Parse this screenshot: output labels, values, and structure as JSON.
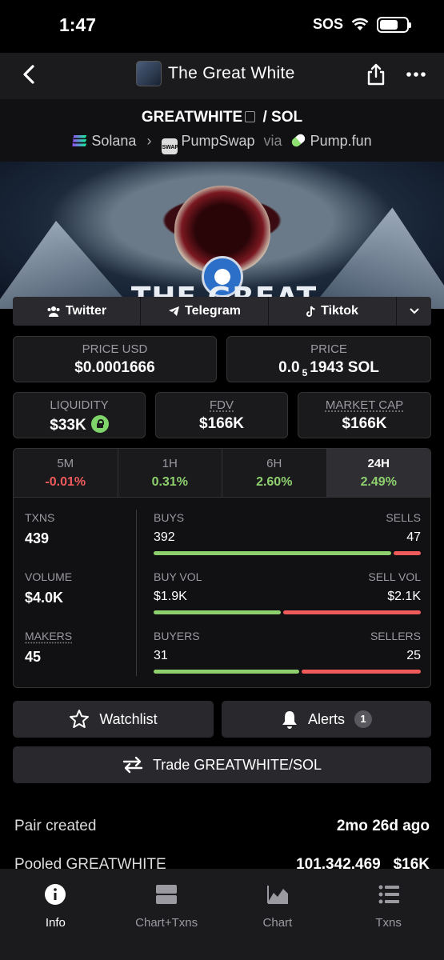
{
  "status_bar": {
    "time": "1:47",
    "carrier": "SOS"
  },
  "nav": {
    "title": "The Great White"
  },
  "pair": {
    "base": "GREATWHITE",
    "separator": "/",
    "quote": "SOL",
    "chain": "Solana",
    "dex": "PumpSwap",
    "via": "via",
    "launchpad": "Pump.fun",
    "dex_icon_text": "SWAP"
  },
  "banner": {
    "text": "THE GREAT WHITE"
  },
  "social": {
    "twitter": "Twitter",
    "telegram": "Telegram",
    "tiktok": "Tiktok"
  },
  "prices": {
    "price_usd_label": "PRICE USD",
    "price_usd": "$0.0001666",
    "price_label": "PRICE",
    "price_sol_prefix": "0.0",
    "price_sol_sub": "5",
    "price_sol_rest": "1943 SOL"
  },
  "metrics": {
    "liquidity_label": "LIQUIDITY",
    "liquidity": "$33K",
    "fdv_label": "FDV",
    "fdv": "$166K",
    "mcap_label": "MARKET CAP",
    "mcap": "$166K"
  },
  "timeframes": [
    {
      "label": "5M",
      "change": "-0.01%"
    },
    {
      "label": "1H",
      "change": "0.31%"
    },
    {
      "label": "6H",
      "change": "2.60%"
    },
    {
      "label": "24H",
      "change": "2.49%"
    }
  ],
  "stats": {
    "txns_label": "TXNS",
    "txns": "439",
    "volume_label": "VOLUME",
    "volume": "$4.0K",
    "makers_label": "MAKERS",
    "makers": "45",
    "buys_label": "BUYS",
    "buys": "392",
    "sells_label": "SELLS",
    "sells": "47",
    "buy_vol_label": "BUY VOL",
    "buy_vol": "$1.9K",
    "sell_vol_label": "SELL VOL",
    "sell_vol": "$2.1K",
    "buyers_label": "BUYERS",
    "buyers": "31",
    "sellers_label": "SELLERS",
    "sellers": "25",
    "buys_fraction": 0.893,
    "buy_vol_fraction": 0.48,
    "buyers_fraction": 0.55
  },
  "actions": {
    "watchlist": "Watchlist",
    "alerts": "Alerts",
    "alerts_count": "1",
    "trade": "Trade GREATWHITE/SOL"
  },
  "info": [
    {
      "key": "Pair created",
      "value": "2mo 26d ago"
    },
    {
      "key": "Pooled GREATWHITE",
      "value": "101,342,469   $16K"
    }
  ],
  "tabs": [
    {
      "label": "Info"
    },
    {
      "label": "Chart+Txns"
    },
    {
      "label": "Chart"
    },
    {
      "label": "Txns"
    }
  ],
  "colors": {
    "positive": "#8fd06e",
    "negative": "#ef5b5b",
    "background": "#000000",
    "card": "#1a1a1d"
  }
}
